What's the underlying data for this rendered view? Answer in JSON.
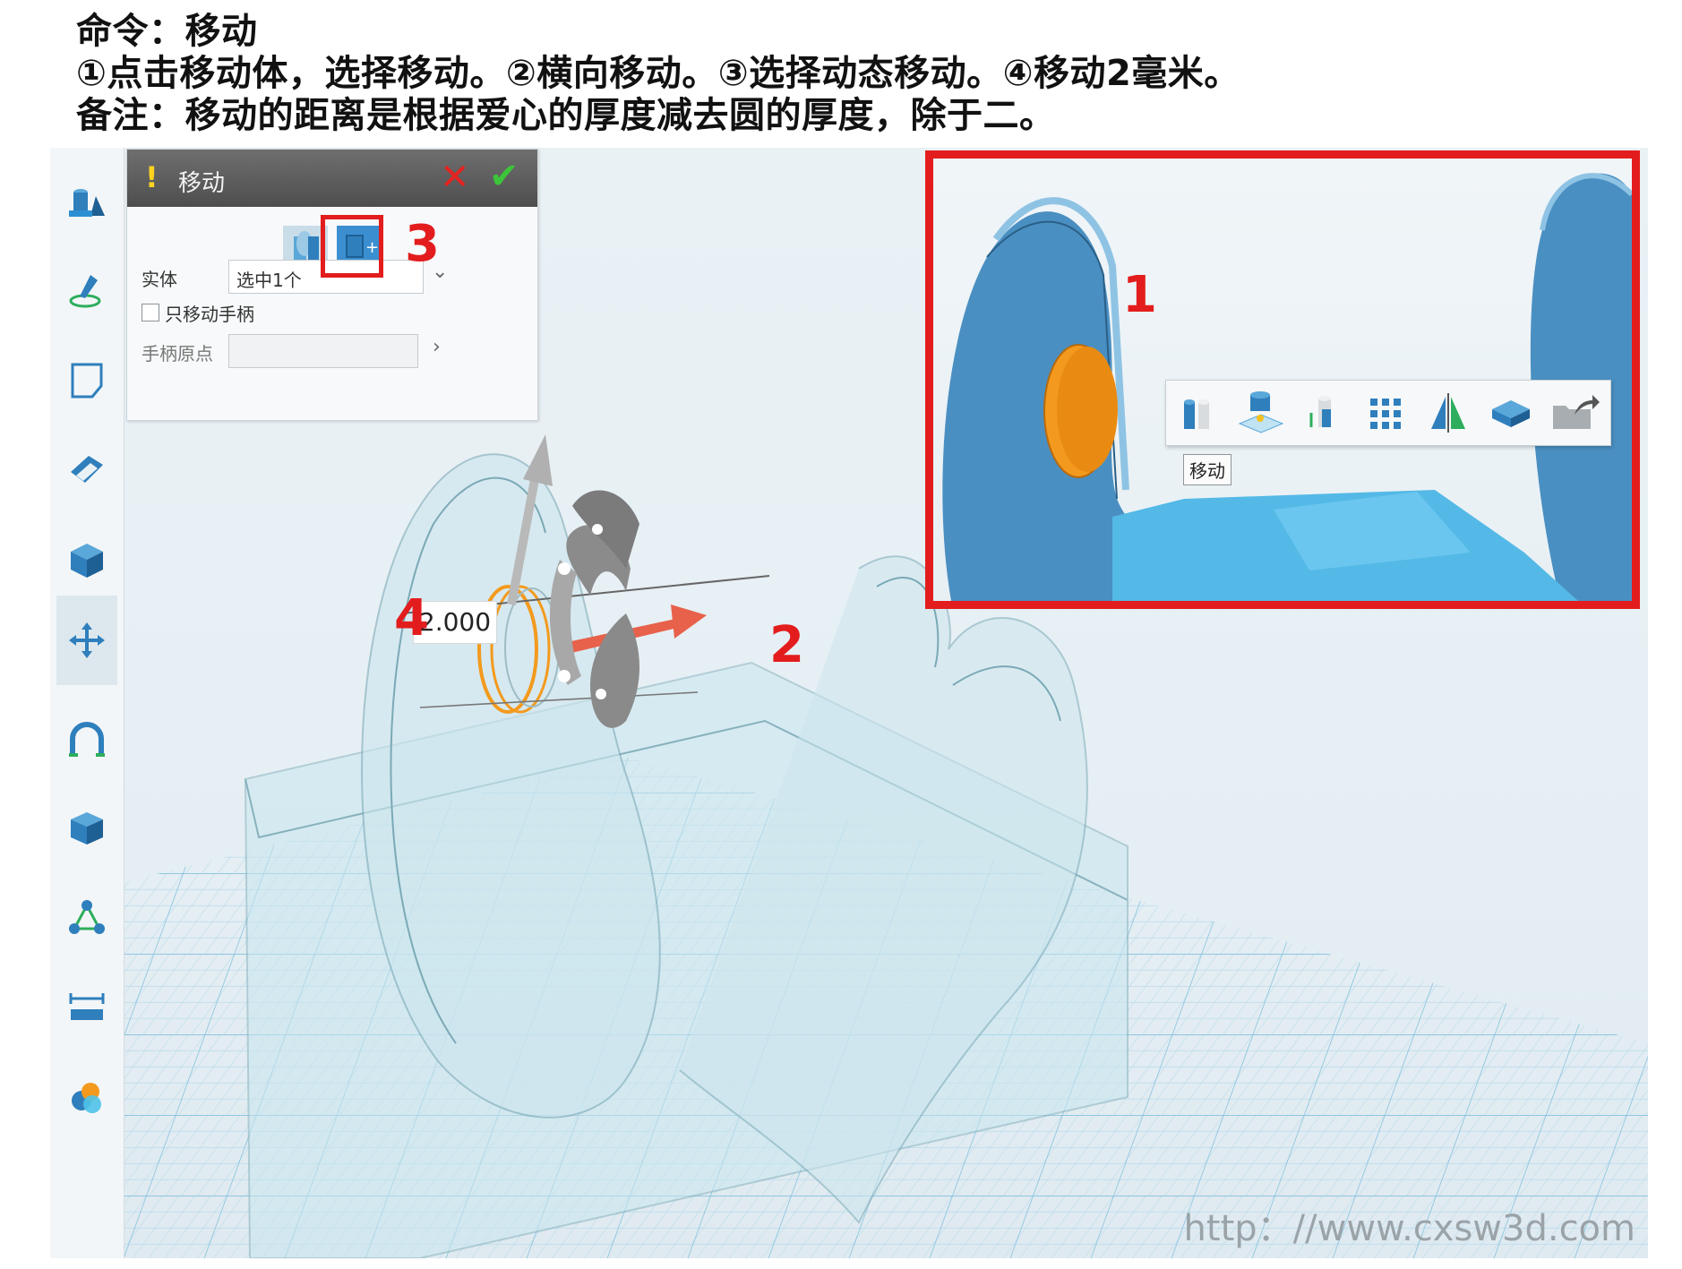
{
  "header": {
    "line1": "命令：移动",
    "line2": "①点击移动体，选择移动。②横向移动。③选择动态移动。④移动2毫米。",
    "line3": "备注：移动的距离是根据爱心的厚度减去圆的厚度，除于二。"
  },
  "sidebar": {
    "items": [
      {
        "icon": "basic-solids-icon"
      },
      {
        "icon": "sketch-icon"
      },
      {
        "icon": "sketch-edit-icon"
      },
      {
        "icon": "feature-icon"
      },
      {
        "icon": "special-feature-icon"
      },
      {
        "icon": "basic-edit-move-icon",
        "active": true
      },
      {
        "icon": "combine-icon"
      },
      {
        "icon": "surface-icon"
      },
      {
        "icon": "assembly-icon"
      },
      {
        "icon": "measure-icon"
      },
      {
        "icon": "render-icon"
      }
    ]
  },
  "panel": {
    "warn": "!",
    "title": "移动",
    "entity_label": "实体",
    "entity_value": "选中1个",
    "only_handle_label": "只移动手柄",
    "handle_origin_label": "手柄原点",
    "handle_origin_value": ""
  },
  "annotations": {
    "n1": "1",
    "n2": "2",
    "n3": "3",
    "n4": "4",
    "distance": "2.000"
  },
  "inset": {
    "toolbar_tools": [
      "move-tool-icon",
      "drop-to-plane-icon",
      "copy-align-icon",
      "array-icon",
      "mirror-icon",
      "scale-icon",
      "save-export-icon"
    ],
    "tooltip": "移动"
  },
  "watermark": "http：//www.cxsw3d.com",
  "colors": {
    "annotation_red": "#e31d1d",
    "grid_blue": "#a9d6ea",
    "model_blue": "#4a8fc2",
    "selection_orange": "#f39a1e"
  }
}
